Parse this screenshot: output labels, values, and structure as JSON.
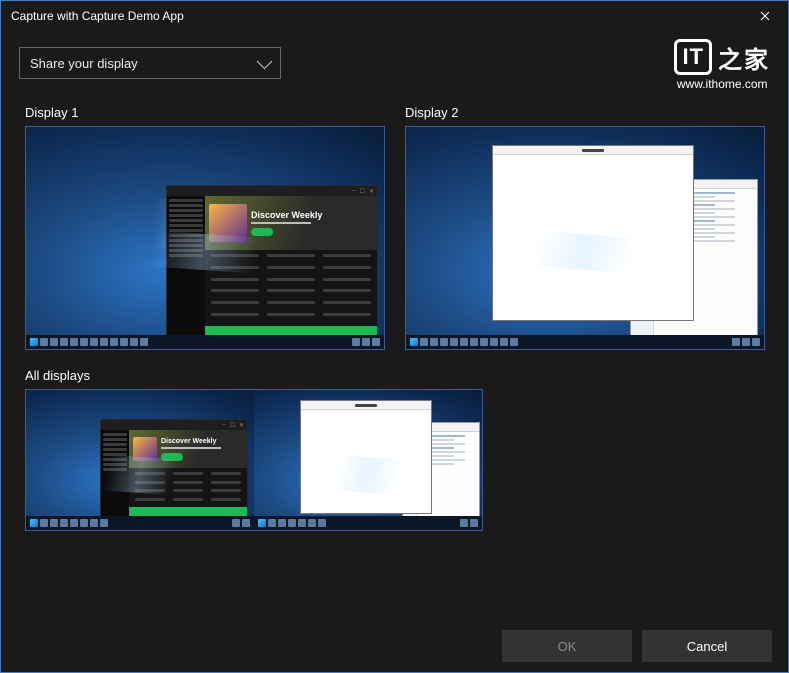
{
  "titlebar": {
    "title": "Capture with Capture Demo App"
  },
  "dropdown": {
    "label": "Share your display"
  },
  "watermark": {
    "logo_text": "IT",
    "cn_text": "之家",
    "url": "www.ithome.com"
  },
  "displays": {
    "d1_label": "Display 1",
    "d2_label": "Display 2",
    "all_label": "All displays",
    "music_app_title": "Discover Weekly"
  },
  "footer": {
    "ok": "OK",
    "cancel": "Cancel"
  }
}
